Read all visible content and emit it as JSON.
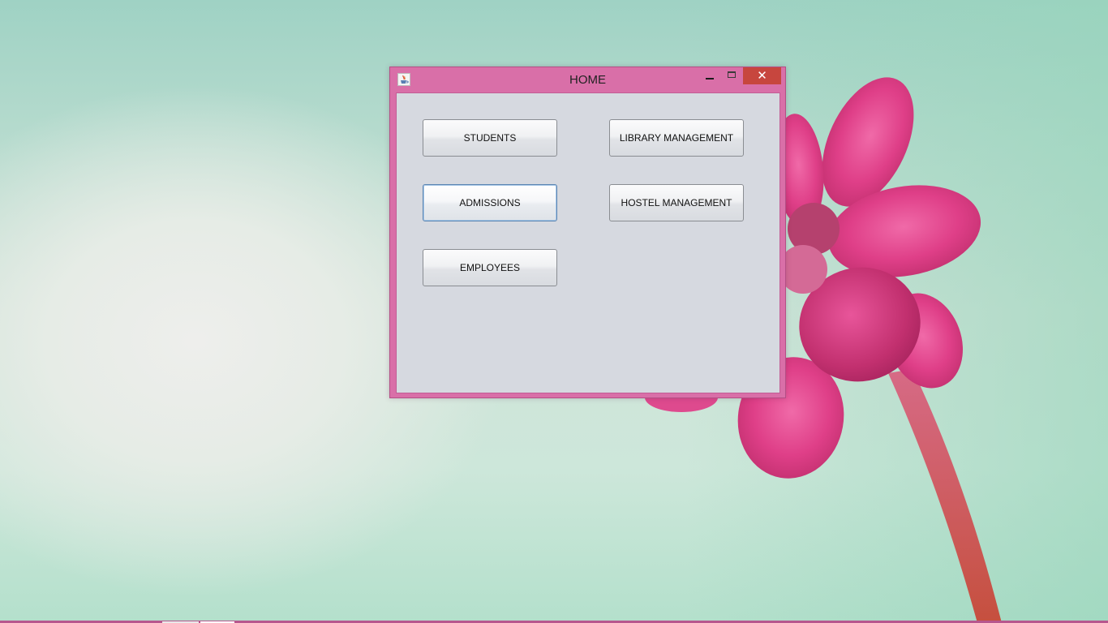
{
  "window": {
    "title": "HOME",
    "close_glyph": "✕",
    "accent_color": "#d96fa8",
    "close_color": "#c7463e"
  },
  "buttons": {
    "students": "STUDENTS",
    "library_management": "LIBRARY MANAGEMENT",
    "admissions": "ADMISSIONS",
    "hostel_management": "HOSTEL MANAGEMENT",
    "employees": "EMPLOYEES"
  },
  "focused_button": "admissions",
  "icons": {
    "app": "java-cup-icon",
    "minimize": "minimize-icon",
    "maximize": "maximize-icon",
    "close": "close-icon"
  }
}
